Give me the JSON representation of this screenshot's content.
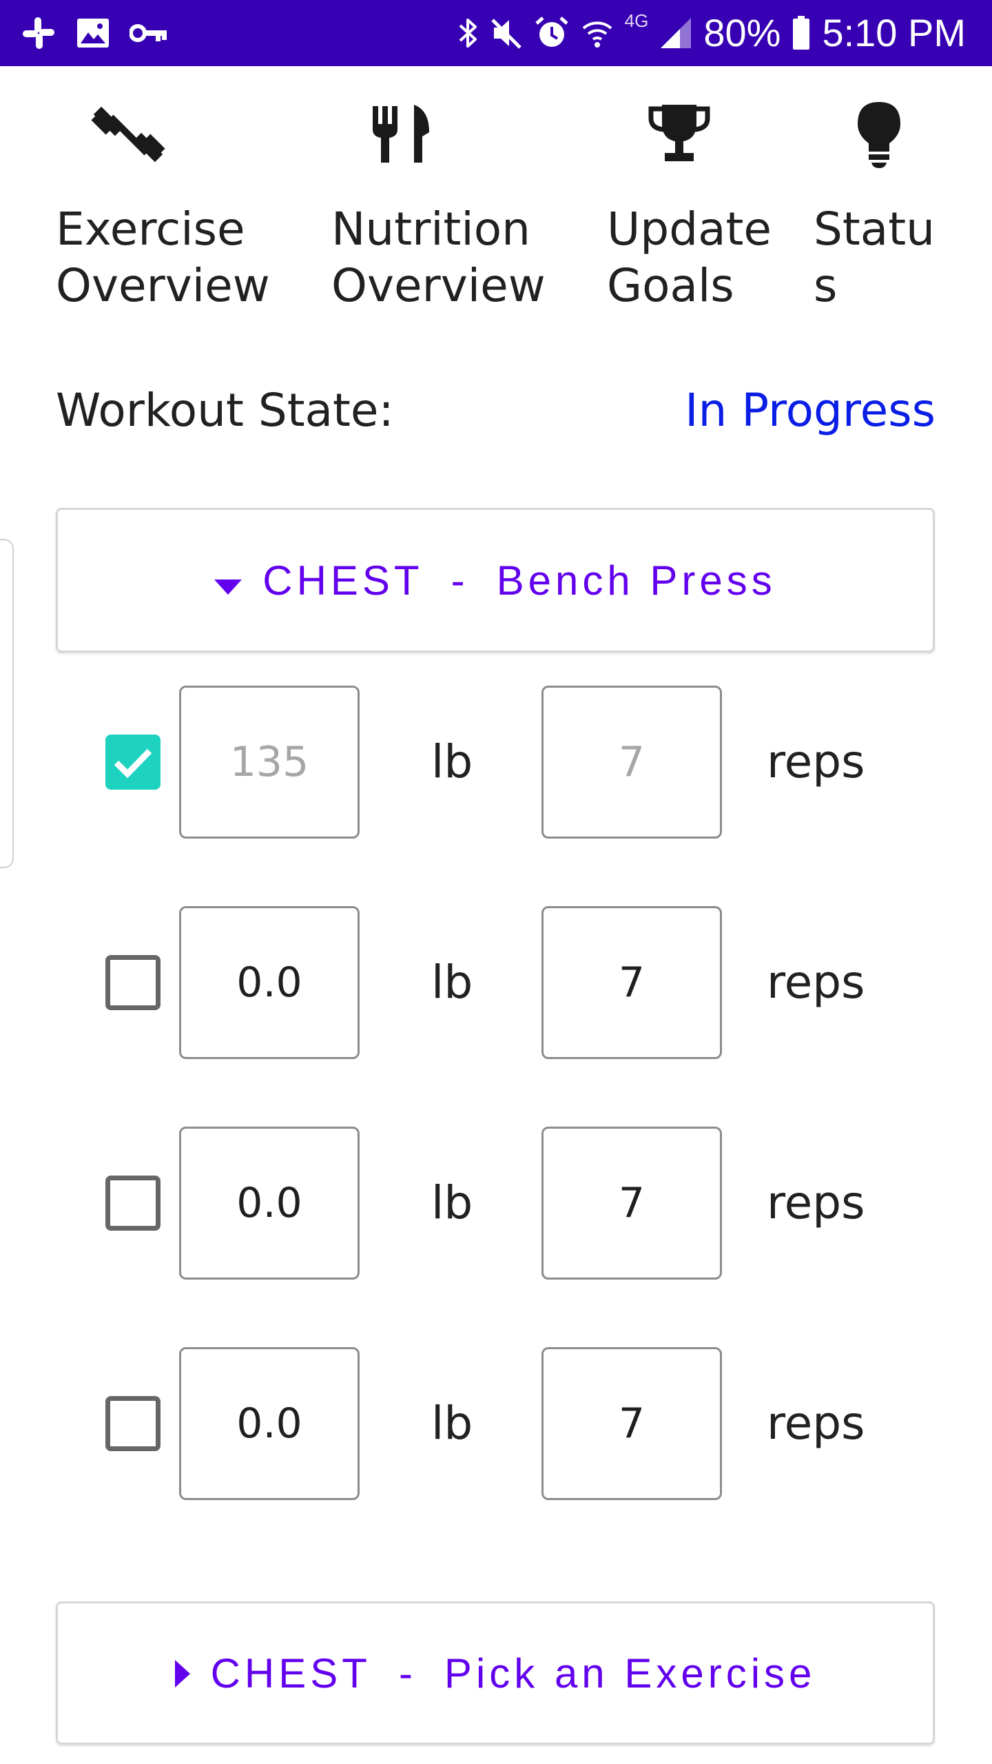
{
  "status_bar": {
    "battery": "80%",
    "time": "5:10 PM",
    "network": "4G",
    "icons": [
      "slack-icon",
      "image-icon",
      "vpn-key-icon",
      "bluetooth-icon",
      "mute-icon",
      "alarm-icon",
      "wifi-icon",
      "signal-icon",
      "battery-icon"
    ]
  },
  "nav": [
    {
      "label": "Exercise\nOverview",
      "icon": "dumbbell-icon"
    },
    {
      "label": "Nutrition\nOverview",
      "icon": "fork-knife-icon"
    },
    {
      "label": "Update\nGoals",
      "icon": "trophy-icon"
    },
    {
      "label": "Statu\ns",
      "icon": "lightbulb-icon"
    }
  ],
  "workout": {
    "state_label": "Workout State:",
    "state_value": "In Progress"
  },
  "exercise_expanded": {
    "group": "CHEST",
    "separator": "-",
    "name": "Bench Press"
  },
  "sets": [
    {
      "checked": true,
      "weight": "135",
      "reps": "7",
      "weight_is_hint": true,
      "reps_is_hint": true,
      "weight_unit": "lb",
      "reps_unit": "reps"
    },
    {
      "checked": false,
      "weight": "0.0",
      "reps": "7",
      "weight_is_hint": false,
      "reps_is_hint": false,
      "weight_unit": "lb",
      "reps_unit": "reps"
    },
    {
      "checked": false,
      "weight": "0.0",
      "reps": "7",
      "weight_is_hint": false,
      "reps_is_hint": false,
      "weight_unit": "lb",
      "reps_unit": "reps"
    },
    {
      "checked": false,
      "weight": "0.0",
      "reps": "7",
      "weight_is_hint": false,
      "reps_is_hint": false,
      "weight_unit": "lb",
      "reps_unit": "reps"
    }
  ],
  "exercise_collapsed": {
    "group": "CHEST",
    "separator": "-",
    "name": "Pick an Exercise"
  },
  "colors": {
    "status_bar": "#3700b3",
    "accent": "#6200ee",
    "state_value": "#0a1ee6",
    "checkbox_checked": "#1ed2c0",
    "hint_text": "#a6a6a6"
  }
}
